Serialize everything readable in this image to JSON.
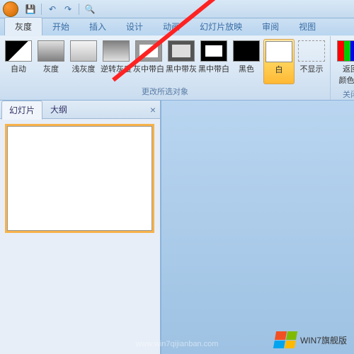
{
  "qat": {
    "tooltip_undo": "↶",
    "tooltip_redo": "↷"
  },
  "tabs": [
    {
      "label": "灰度",
      "active": true
    },
    {
      "label": "开始"
    },
    {
      "label": "插入"
    },
    {
      "label": "设计"
    },
    {
      "label": "动画"
    },
    {
      "label": "幻灯片放映"
    },
    {
      "label": "审阅"
    },
    {
      "label": "视图"
    }
  ],
  "ribbon": {
    "buttons": [
      {
        "label": "自动",
        "swatch": "sw-auto"
      },
      {
        "label": "灰度",
        "swatch": "sw-gray"
      },
      {
        "label": "浅灰度",
        "swatch": "sw-lightgray"
      },
      {
        "label": "逆转灰度",
        "swatch": "sw-invgray"
      },
      {
        "label": "灰中带白",
        "swatch": "sw-graywhite"
      },
      {
        "label": "黑中带灰",
        "swatch": "sw-blackgray"
      },
      {
        "label": "黑中带白",
        "swatch": "sw-blackwhite"
      },
      {
        "label": "黑色",
        "swatch": "sw-black"
      },
      {
        "label": "白",
        "swatch": "sw-white",
        "selected": true
      },
      {
        "label": "不显示",
        "swatch": "sw-noshow"
      }
    ],
    "group_label": "更改所选对象",
    "return_label": "返回",
    "return_sub": "颜色视",
    "return_group_label": "关闭"
  },
  "panel": {
    "tabs": [
      {
        "label": "幻灯片",
        "active": true
      },
      {
        "label": "大纲"
      }
    ],
    "close": "×"
  },
  "watermark": {
    "text": "WIN7旗舰版",
    "url": "www.win7qijianban.com"
  }
}
